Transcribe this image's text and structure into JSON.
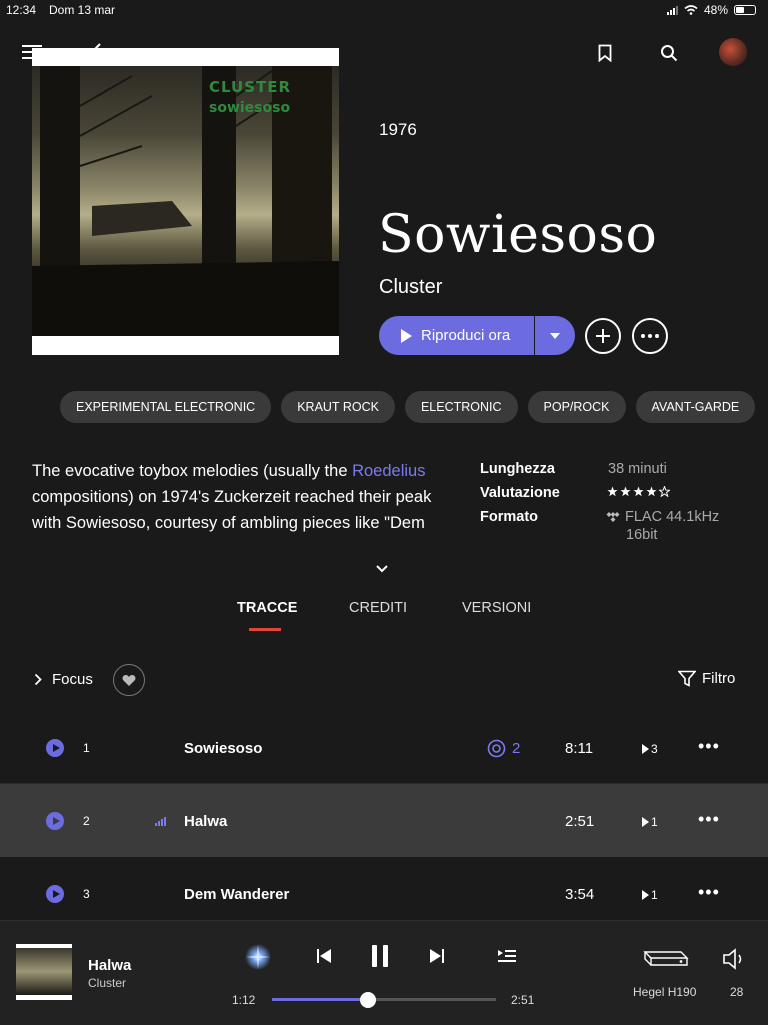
{
  "status": {
    "time": "12:34",
    "date": "Dom 13 mar",
    "battery": "48%"
  },
  "album": {
    "cover_text_1": "CLUSTER",
    "cover_text_2": "sowiesoso",
    "year": "1976",
    "title": "Sowiesoso",
    "artist": "Cluster",
    "play_label": "Riproduci ora"
  },
  "tags": [
    "EXPERIMENTAL ELECTRONIC",
    "KRAUT ROCK",
    "ELECTRONIC",
    "POP/ROCK",
    "AVANT-GARDE"
  ],
  "description": {
    "part1": "The evocative toybox melodies (usually the ",
    "link": "Roedelius",
    "part2": " compositions) on 1974's Zuckerzeit reached their peak with Sowiesoso, courtesy of ambling pieces like \"Dem"
  },
  "meta": {
    "length_label": "Lunghezza",
    "length_value": "38 minuti",
    "rating_label": "Valutazione",
    "rating_stars": 4,
    "format_label": "Formato",
    "format_value": "FLAC 44.1kHz",
    "format_value_2": "16bit"
  },
  "tabs": [
    "TRACCE",
    "CREDITI",
    "VERSIONI"
  ],
  "controls": {
    "focus_label": "Focus",
    "filter_label": "Filtro"
  },
  "tracks": [
    {
      "num": "1",
      "title": "Sowiesoso",
      "versions": "2",
      "duration": "8:11",
      "plays": "3"
    },
    {
      "num": "2",
      "title": "Halwa",
      "versions": "",
      "duration": "2:51",
      "plays": "1"
    },
    {
      "num": "3",
      "title": "Dem Wanderer",
      "versions": "",
      "duration": "3:54",
      "plays": "1"
    }
  ],
  "player": {
    "title": "Halwa",
    "artist": "Cluster",
    "elapsed": "1:12",
    "total": "2:51",
    "progress": 0.43,
    "device": "Hegel H190",
    "volume": "28"
  },
  "colors": {
    "accent": "#6c6ce0",
    "tab_underline": "#e0443a",
    "background": "#1a1a1a"
  }
}
